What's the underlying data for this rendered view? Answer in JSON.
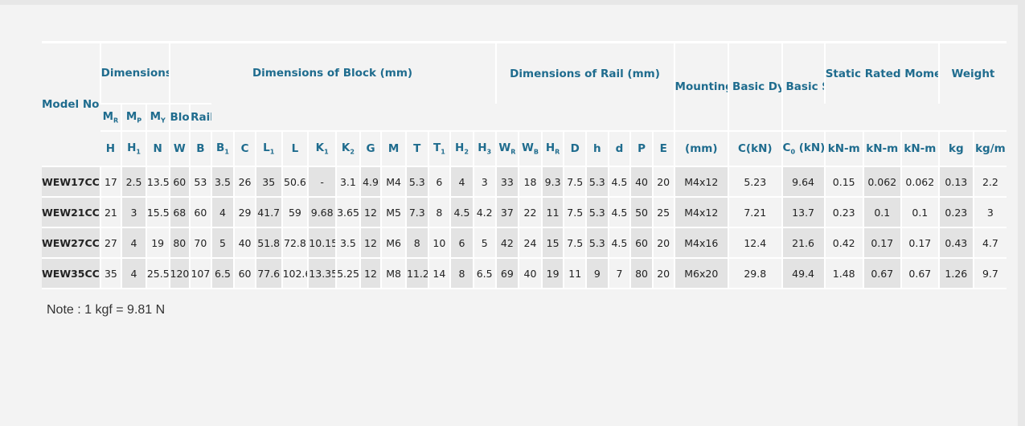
{
  "header": {
    "model": "Model No.",
    "assembly": "Dimensions of Assembly (mm)",
    "block": "Dimensions of Block (mm)",
    "rail": "Dimensions of Rail (mm)",
    "bolt": "Mounting Bolt for Rail",
    "dynamic": "Basic Dynamic Load Rating",
    "static": "Basic Static Load Rating",
    "moment": "Static Rated Moment",
    "weight": "Weight",
    "moment_subs": {
      "mr_base": "M",
      "mr_sub": "R",
      "mp_base": "M",
      "mp_sub": "P",
      "my_base": "M",
      "my_sub": "Y"
    },
    "weight_subs": {
      "block": "Block",
      "rail": "Rail"
    },
    "symbols": {
      "H": "H",
      "H1_base": "H",
      "H1_sub": "1",
      "N": "N",
      "W": "W",
      "B": "B",
      "B1_base": "B",
      "B1_sub": "1",
      "C": "C",
      "L1_base": "L",
      "L1_sub": "1",
      "L": "L",
      "K1_base": "K",
      "K1_sub": "1",
      "K2_base": "K",
      "K2_sub": "2",
      "G": "G",
      "M": "M",
      "T": "T",
      "T1_base": "T",
      "T1_sub": "1",
      "H2_base": "H",
      "H2_sub": "2",
      "H3_base": "H",
      "H3_sub": "3",
      "WR_base": "W",
      "WR_sub": "R",
      "WB_base": "W",
      "WB_sub": "B",
      "HR_base": "H",
      "HR_sub": "R",
      "D": "D",
      "h": "h",
      "d": "d",
      "P": "P",
      "E": "E"
    },
    "units": {
      "bolt": "(mm)",
      "dynamic": "C(kN)",
      "static_base": "C",
      "static_sub": "0",
      "static_tail": " (kN)",
      "mr": "kN-m",
      "mp": "kN-m",
      "my": "kN-m",
      "block": "kg",
      "rail": "kg/m"
    }
  },
  "rows": [
    [
      "WEW17CC",
      "17",
      "2.5",
      "13.5",
      "60",
      "53",
      "3.5",
      "26",
      "35",
      "50.6",
      "-",
      "3.1",
      "4.9",
      "M4",
      "5.3",
      "6",
      "4",
      "3",
      "33",
      "18",
      "9.3",
      "7.5",
      "5.3",
      "4.5",
      "40",
      "20",
      "M4x12",
      "5.23",
      "9.64",
      "0.15",
      "0.062",
      "0.062",
      "0.13",
      "2.2"
    ],
    [
      "WEW21CC",
      "21",
      "3",
      "15.5",
      "68",
      "60",
      "4",
      "29",
      "41.7",
      "59",
      "9.68",
      "3.65",
      "12",
      "M5",
      "7.3",
      "8",
      "4.5",
      "4.2",
      "37",
      "22",
      "11",
      "7.5",
      "5.3",
      "4.5",
      "50",
      "25",
      "M4x12",
      "7.21",
      "13.7",
      "0.23",
      "0.1",
      "0.1",
      "0.23",
      "3"
    ],
    [
      "WEW27CC",
      "27",
      "4",
      "19",
      "80",
      "70",
      "5",
      "40",
      "51.8",
      "72.8",
      "10.15",
      "3.5",
      "12",
      "M6",
      "8",
      "10",
      "6",
      "5",
      "42",
      "24",
      "15",
      "7.5",
      "5.3",
      "4.5",
      "60",
      "20",
      "M4x16",
      "12.4",
      "21.6",
      "0.42",
      "0.17",
      "0.17",
      "0.43",
      "4.7"
    ],
    [
      "WEW35CC",
      "35",
      "4",
      "25.5",
      "120",
      "107",
      "6.5",
      "60",
      "77.6",
      "102.6",
      "13.35",
      "5.25",
      "12",
      "M8",
      "11.2",
      "14",
      "8",
      "6.5",
      "69",
      "40",
      "19",
      "11",
      "9",
      "7",
      "80",
      "20",
      "M6x20",
      "29.8",
      "49.4",
      "1.48",
      "0.67",
      "0.67",
      "1.26",
      "9.7"
    ]
  ],
  "note": "Note : 1 kgf = 9.81 N"
}
